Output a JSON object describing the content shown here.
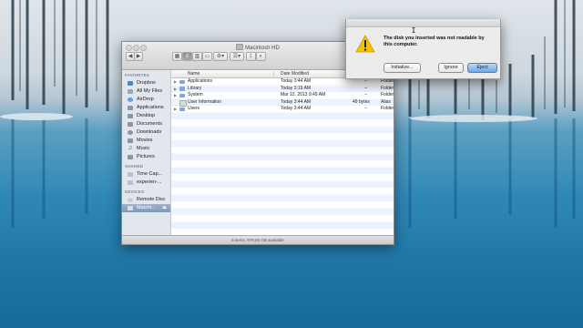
{
  "finder": {
    "title": "Macintosh HD",
    "search_placeholder": "",
    "sidebar": {
      "favorites_header": "FAVORITES",
      "favorites": [
        {
          "label": "Dropbox",
          "icon": "dropbox-icon"
        },
        {
          "label": "All My Files",
          "icon": "all-files-icon"
        },
        {
          "label": "AirDrop",
          "icon": "airdrop-icon"
        },
        {
          "label": "Applications",
          "icon": "applications-icon"
        },
        {
          "label": "Desktop",
          "icon": "desktop-icon"
        },
        {
          "label": "Documents",
          "icon": "documents-icon"
        },
        {
          "label": "Downloads",
          "icon": "downloads-icon"
        },
        {
          "label": "Movies",
          "icon": "movies-icon"
        },
        {
          "label": "Music",
          "icon": "music-icon"
        },
        {
          "label": "Pictures",
          "icon": "pictures-icon"
        }
      ],
      "shared_header": "SHARED",
      "shared": [
        {
          "label": "Time Cap...",
          "icon": "time-capsule-icon"
        },
        {
          "label": "experien-...",
          "icon": "computer-icon"
        }
      ],
      "devices_header": "DEVICES",
      "devices": [
        {
          "label": "Remote Disc",
          "icon": "remote-disc-icon"
        },
        {
          "label": "Macint...",
          "icon": "hard-drive-icon",
          "selected": true
        }
      ]
    },
    "columns": {
      "name": "Name",
      "date": "Date Modified"
    },
    "rows": [
      {
        "name": "Applications",
        "date": "Today 3:44 AM",
        "size": "--",
        "kind": "Folder",
        "alias": false
      },
      {
        "name": "Library",
        "date": "Today 3:19 AM",
        "size": "--",
        "kind": "Folder",
        "alias": false
      },
      {
        "name": "System",
        "date": "Mar 12, 2013 9:49 AM",
        "size": "--",
        "kind": "Folder",
        "alias": false
      },
      {
        "name": "User Information",
        "date": "Today 3:44 AM",
        "size": "49 bytes",
        "kind": "Alias",
        "alias": true
      },
      {
        "name": "Users",
        "date": "Today 3:44 AM",
        "size": "--",
        "kind": "Folder",
        "alias": false
      }
    ],
    "status": "5 items, 979.06 GB available"
  },
  "alert": {
    "message": "The disk you inserted was not readable by this computer.",
    "buttons": {
      "initialize": "Initialize...",
      "ignore": "Ignore",
      "eject": "Eject"
    }
  },
  "colors": {
    "accent": "#6fa7e6",
    "sidebar_selection": "#8aa2c0",
    "warning": "#f5c400"
  }
}
